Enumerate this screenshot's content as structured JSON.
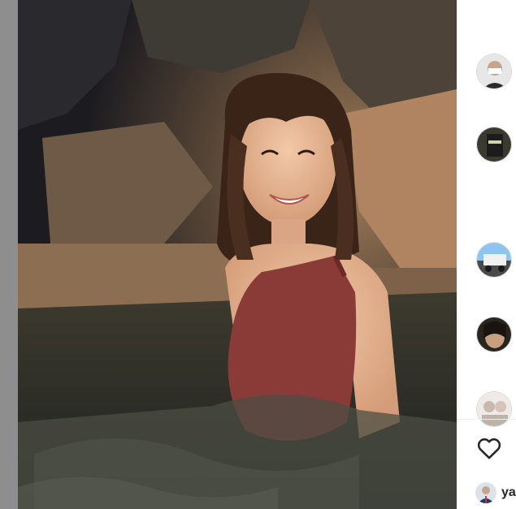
{
  "post": {
    "photo_description_icon": "person-photo",
    "footer_username": "ya"
  },
  "rail": {
    "items": [
      {
        "icon": "story-avatar-1"
      },
      {
        "icon": "story-avatar-2"
      },
      {
        "icon": "story-avatar-3"
      },
      {
        "icon": "story-avatar-4"
      },
      {
        "icon": "story-avatar-5"
      }
    ],
    "like_icon": "heart-icon"
  },
  "colors": {
    "left_strip": "#8e8e8e",
    "dress": "#8a3b38",
    "background": "#ffffff"
  }
}
